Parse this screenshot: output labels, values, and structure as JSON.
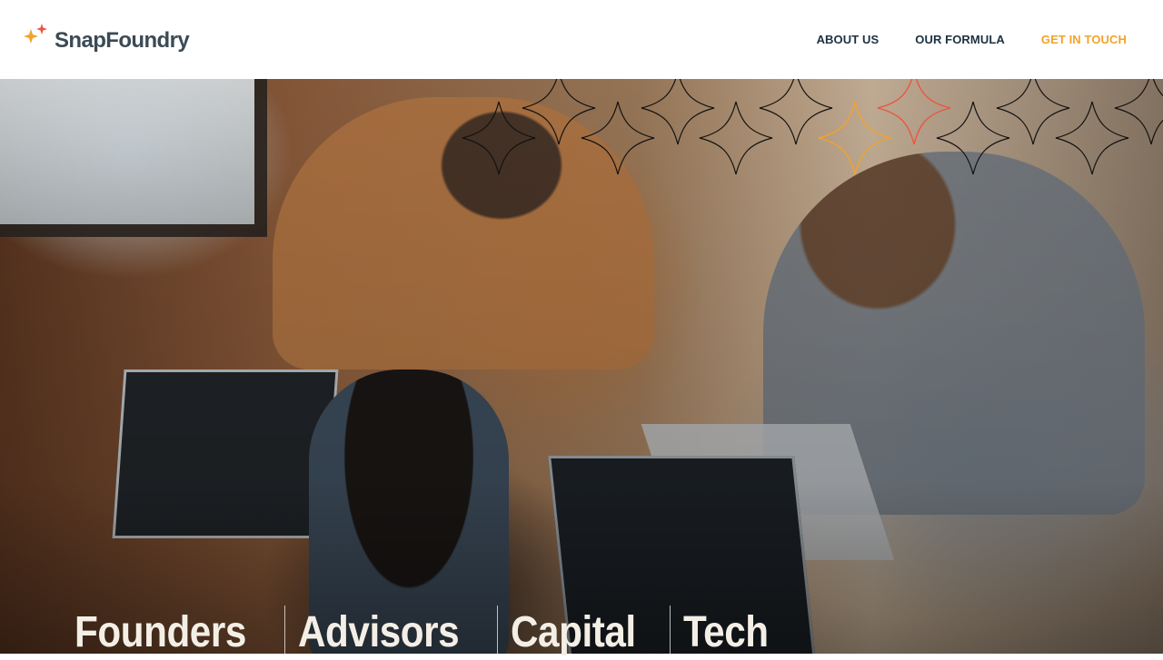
{
  "brand": {
    "name": "SnapFoundry",
    "logo_icon": "sparkle-icon",
    "colors": {
      "accent_orange": "#f2a32a",
      "accent_red": "#e9573f",
      "navy": "#1c3140"
    }
  },
  "nav": {
    "items": [
      {
        "label": "ABOUT US"
      },
      {
        "label": "OUR FORMULA"
      },
      {
        "label": "GET IN TOUCH"
      }
    ]
  },
  "hero": {
    "pillars": [
      "Founders",
      "Advisors",
      "Capital",
      "Tech"
    ]
  }
}
